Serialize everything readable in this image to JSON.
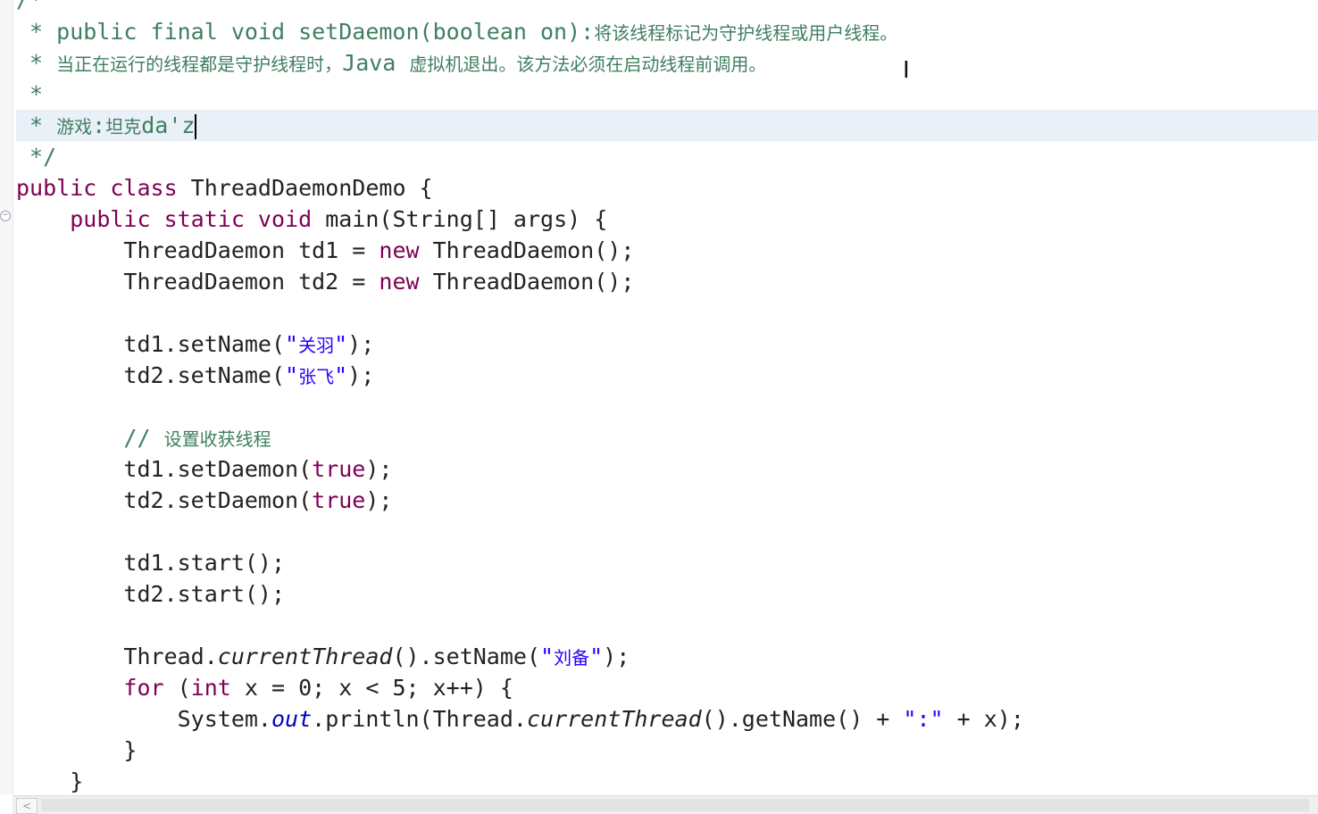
{
  "editor": {
    "lines": [
      {
        "parts": [
          {
            "t": " * public final void setDaemon(boolean on):",
            "c": "cmt"
          },
          {
            "t": "将该线程标记为守护线程或用户线程。",
            "c": "cmt cjk"
          }
        ]
      },
      {
        "parts": [
          {
            "t": " * ",
            "c": "cmt"
          },
          {
            "t": "当正在运行的线程都是守护线程时，",
            "c": "cmt cjk"
          },
          {
            "t": "Java ",
            "c": "cmt"
          },
          {
            "t": "虚拟机退出。该方法必须在启动线程前调用。",
            "c": "cmt cjk"
          }
        ]
      },
      {
        "parts": [
          {
            "t": " *",
            "c": "cmt"
          }
        ]
      },
      {
        "parts": [
          {
            "t": " * ",
            "c": "cmt"
          },
          {
            "t": "游戏",
            "c": "cmt cjk"
          },
          {
            "t": ":",
            "c": "cmt"
          },
          {
            "t": "坦克",
            "c": "cmt cjk"
          },
          {
            "t": "da'z",
            "c": "cmt"
          }
        ],
        "current": true,
        "caret": true
      },
      {
        "parts": [
          {
            "t": " */",
            "c": "cmt"
          }
        ]
      },
      {
        "parts": [
          {
            "t": "public class",
            "c": "kw-light"
          },
          {
            "t": " ThreadDaemonDemo {",
            "c": ""
          }
        ]
      },
      {
        "parts": [
          {
            "t": "    ",
            "c": ""
          },
          {
            "t": "public static void",
            "c": "kw-light"
          },
          {
            "t": " main(String[] args) {",
            "c": ""
          }
        ]
      },
      {
        "parts": [
          {
            "t": "        ThreadDaemon td1 = ",
            "c": ""
          },
          {
            "t": "new",
            "c": "kw-light"
          },
          {
            "t": " ThreadDaemon();",
            "c": ""
          }
        ]
      },
      {
        "parts": [
          {
            "t": "        ThreadDaemon td2 = ",
            "c": ""
          },
          {
            "t": "new",
            "c": "kw-light"
          },
          {
            "t": " ThreadDaemon();",
            "c": ""
          }
        ]
      },
      {
        "parts": []
      },
      {
        "parts": [
          {
            "t": "        td1.setName(",
            "c": ""
          },
          {
            "t": "\"",
            "c": "str"
          },
          {
            "t": "关羽",
            "c": "str cjk"
          },
          {
            "t": "\"",
            "c": "str"
          },
          {
            "t": ");",
            "c": ""
          }
        ]
      },
      {
        "parts": [
          {
            "t": "        td2.setName(",
            "c": ""
          },
          {
            "t": "\"",
            "c": "str"
          },
          {
            "t": "张飞",
            "c": "str cjk"
          },
          {
            "t": "\"",
            "c": "str"
          },
          {
            "t": ");",
            "c": ""
          }
        ]
      },
      {
        "parts": []
      },
      {
        "parts": [
          {
            "t": "        // ",
            "c": "cmt"
          },
          {
            "t": "设置收获线程",
            "c": "cmt cjk"
          }
        ]
      },
      {
        "parts": [
          {
            "t": "        td1.setDaemon(",
            "c": ""
          },
          {
            "t": "true",
            "c": "kw-light"
          },
          {
            "t": ");",
            "c": ""
          }
        ]
      },
      {
        "parts": [
          {
            "t": "        td2.setDaemon(",
            "c": ""
          },
          {
            "t": "true",
            "c": "kw-light"
          },
          {
            "t": ");",
            "c": ""
          }
        ]
      },
      {
        "parts": []
      },
      {
        "parts": [
          {
            "t": "        td1.start();",
            "c": ""
          }
        ]
      },
      {
        "parts": [
          {
            "t": "        td2.start();",
            "c": ""
          }
        ]
      },
      {
        "parts": []
      },
      {
        "parts": [
          {
            "t": "        Thread.",
            "c": ""
          },
          {
            "t": "currentThread",
            "c": "ital"
          },
          {
            "t": "().setName(",
            "c": ""
          },
          {
            "t": "\"",
            "c": "str"
          },
          {
            "t": "刘备",
            "c": "str cjk"
          },
          {
            "t": "\"",
            "c": "str"
          },
          {
            "t": ");",
            "c": ""
          }
        ]
      },
      {
        "parts": [
          {
            "t": "        ",
            "c": ""
          },
          {
            "t": "for",
            "c": "kw-light"
          },
          {
            "t": " (",
            "c": ""
          },
          {
            "t": "int",
            "c": "kw-light"
          },
          {
            "t": " x = 0; x < 5; x++) {",
            "c": ""
          }
        ]
      },
      {
        "parts": [
          {
            "t": "            System.",
            "c": ""
          },
          {
            "t": "out",
            "c": "field"
          },
          {
            "t": ".println(Thread.",
            "c": ""
          },
          {
            "t": "currentThread",
            "c": "ital"
          },
          {
            "t": "().getName() + ",
            "c": ""
          },
          {
            "t": "\":\"",
            "c": "str"
          },
          {
            "t": " + x);",
            "c": ""
          }
        ]
      },
      {
        "parts": [
          {
            "t": "        }",
            "c": ""
          }
        ]
      },
      {
        "parts": [
          {
            "t": "    }",
            "c": ""
          }
        ]
      }
    ],
    "top_fragment": "/*",
    "fold_icon": "minus",
    "scroll_left_arrow": "<"
  }
}
